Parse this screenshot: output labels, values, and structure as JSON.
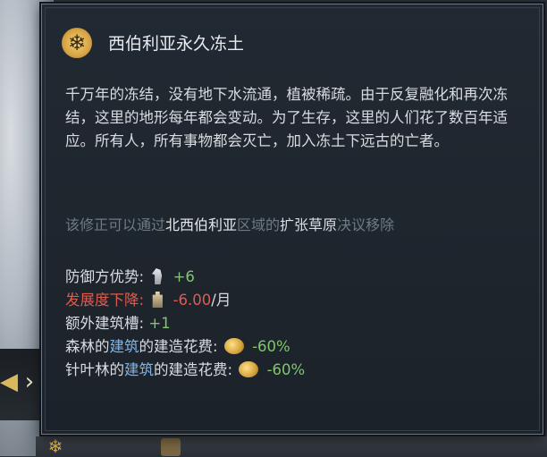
{
  "tooltip": {
    "title": "西伯利亚永久冻土",
    "header_icon": "snowflake-icon",
    "description": "千万年的冻结，没有地下水流通，植被稀疏。由于反复融化和再次冻结，这里的地形每年都会变动。为了生存，这里的人们花了数百年适应。所有人，所有事物都会灭亡，加入冻土下远古的亡者。",
    "removal": {
      "part1": "该修正可以通过",
      "region": "北西伯利亚",
      "part2": "区域的",
      "decision": "扩张草原",
      "part3": "决议移除"
    },
    "modifiers": [
      {
        "label": "防御方优势:",
        "icon": "horse-icon",
        "value": "+6",
        "suffix": ""
      },
      {
        "label": "发展度下降:",
        "icon": "tower-icon",
        "value": "-6.00",
        "suffix": "/月"
      },
      {
        "label": "额外建筑槽:",
        "icon": "",
        "value": "+1",
        "suffix": ""
      },
      {
        "label_a": "森林的",
        "label_b": "建筑",
        "label_c": "的建造花费:",
        "icon": "coins-icon",
        "value": "-60%"
      },
      {
        "label_a": "针叶林的",
        "label_b": "建筑",
        "label_c": "的建造花费:",
        "icon": "coins-icon",
        "value": "-60%"
      }
    ]
  },
  "colors": {
    "positive": "#7fc76a",
    "negative": "#e05a4e",
    "link": "#7fb3e6",
    "muted": "#6f7a85"
  }
}
